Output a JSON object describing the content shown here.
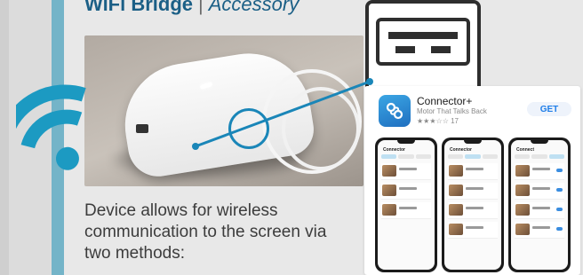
{
  "header": {
    "title_bold": "WiFi Bridge",
    "separator": "|",
    "title_italic": "Accessory"
  },
  "description": "Device allows for wireless communication to the screen via two methods:",
  "app": {
    "name": "Connector+",
    "subtitle": "Motor That Talks Back",
    "rating_stars": "★★★☆☆",
    "rating_count": "17",
    "get_label": "GET"
  },
  "phones": [
    {
      "header": "Connector"
    },
    {
      "header": "Connector"
    },
    {
      "header": "Connect"
    }
  ],
  "colors": {
    "accent_blue": "#1b5f86",
    "panel_border": "#74b4c8",
    "wifi_blue": "#1c9ac2"
  }
}
